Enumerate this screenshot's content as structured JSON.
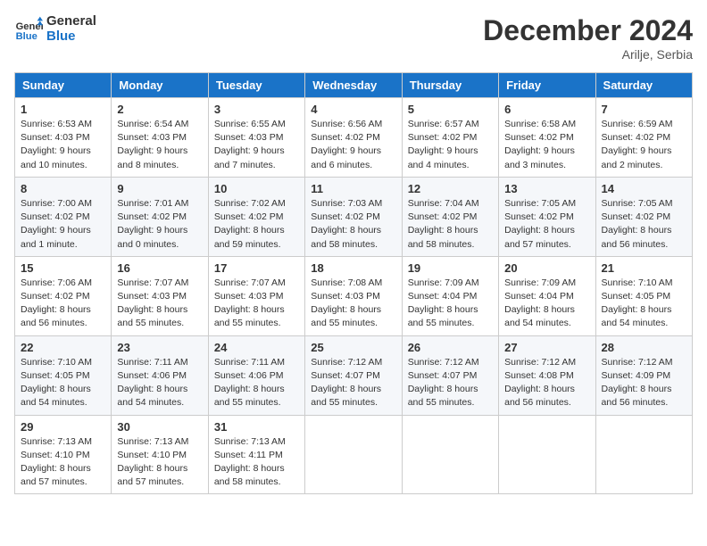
{
  "header": {
    "logo_line1": "General",
    "logo_line2": "Blue",
    "month_title": "December 2024",
    "location": "Arilje, Serbia"
  },
  "weekdays": [
    "Sunday",
    "Monday",
    "Tuesday",
    "Wednesday",
    "Thursday",
    "Friday",
    "Saturday"
  ],
  "weeks": [
    [
      {
        "day": "1",
        "info": "Sunrise: 6:53 AM\nSunset: 4:03 PM\nDaylight: 9 hours and 10 minutes."
      },
      {
        "day": "2",
        "info": "Sunrise: 6:54 AM\nSunset: 4:03 PM\nDaylight: 9 hours and 8 minutes."
      },
      {
        "day": "3",
        "info": "Sunrise: 6:55 AM\nSunset: 4:03 PM\nDaylight: 9 hours and 7 minutes."
      },
      {
        "day": "4",
        "info": "Sunrise: 6:56 AM\nSunset: 4:02 PM\nDaylight: 9 hours and 6 minutes."
      },
      {
        "day": "5",
        "info": "Sunrise: 6:57 AM\nSunset: 4:02 PM\nDaylight: 9 hours and 4 minutes."
      },
      {
        "day": "6",
        "info": "Sunrise: 6:58 AM\nSunset: 4:02 PM\nDaylight: 9 hours and 3 minutes."
      },
      {
        "day": "7",
        "info": "Sunrise: 6:59 AM\nSunset: 4:02 PM\nDaylight: 9 hours and 2 minutes."
      }
    ],
    [
      {
        "day": "8",
        "info": "Sunrise: 7:00 AM\nSunset: 4:02 PM\nDaylight: 9 hours and 1 minute."
      },
      {
        "day": "9",
        "info": "Sunrise: 7:01 AM\nSunset: 4:02 PM\nDaylight: 9 hours and 0 minutes."
      },
      {
        "day": "10",
        "info": "Sunrise: 7:02 AM\nSunset: 4:02 PM\nDaylight: 8 hours and 59 minutes."
      },
      {
        "day": "11",
        "info": "Sunrise: 7:03 AM\nSunset: 4:02 PM\nDaylight: 8 hours and 58 minutes."
      },
      {
        "day": "12",
        "info": "Sunrise: 7:04 AM\nSunset: 4:02 PM\nDaylight: 8 hours and 58 minutes."
      },
      {
        "day": "13",
        "info": "Sunrise: 7:05 AM\nSunset: 4:02 PM\nDaylight: 8 hours and 57 minutes."
      },
      {
        "day": "14",
        "info": "Sunrise: 7:05 AM\nSunset: 4:02 PM\nDaylight: 8 hours and 56 minutes."
      }
    ],
    [
      {
        "day": "15",
        "info": "Sunrise: 7:06 AM\nSunset: 4:02 PM\nDaylight: 8 hours and 56 minutes."
      },
      {
        "day": "16",
        "info": "Sunrise: 7:07 AM\nSunset: 4:03 PM\nDaylight: 8 hours and 55 minutes."
      },
      {
        "day": "17",
        "info": "Sunrise: 7:07 AM\nSunset: 4:03 PM\nDaylight: 8 hours and 55 minutes."
      },
      {
        "day": "18",
        "info": "Sunrise: 7:08 AM\nSunset: 4:03 PM\nDaylight: 8 hours and 55 minutes."
      },
      {
        "day": "19",
        "info": "Sunrise: 7:09 AM\nSunset: 4:04 PM\nDaylight: 8 hours and 55 minutes."
      },
      {
        "day": "20",
        "info": "Sunrise: 7:09 AM\nSunset: 4:04 PM\nDaylight: 8 hours and 54 minutes."
      },
      {
        "day": "21",
        "info": "Sunrise: 7:10 AM\nSunset: 4:05 PM\nDaylight: 8 hours and 54 minutes."
      }
    ],
    [
      {
        "day": "22",
        "info": "Sunrise: 7:10 AM\nSunset: 4:05 PM\nDaylight: 8 hours and 54 minutes."
      },
      {
        "day": "23",
        "info": "Sunrise: 7:11 AM\nSunset: 4:06 PM\nDaylight: 8 hours and 54 minutes."
      },
      {
        "day": "24",
        "info": "Sunrise: 7:11 AM\nSunset: 4:06 PM\nDaylight: 8 hours and 55 minutes."
      },
      {
        "day": "25",
        "info": "Sunrise: 7:12 AM\nSunset: 4:07 PM\nDaylight: 8 hours and 55 minutes."
      },
      {
        "day": "26",
        "info": "Sunrise: 7:12 AM\nSunset: 4:07 PM\nDaylight: 8 hours and 55 minutes."
      },
      {
        "day": "27",
        "info": "Sunrise: 7:12 AM\nSunset: 4:08 PM\nDaylight: 8 hours and 56 minutes."
      },
      {
        "day": "28",
        "info": "Sunrise: 7:12 AM\nSunset: 4:09 PM\nDaylight: 8 hours and 56 minutes."
      }
    ],
    [
      {
        "day": "29",
        "info": "Sunrise: 7:13 AM\nSunset: 4:10 PM\nDaylight: 8 hours and 57 minutes."
      },
      {
        "day": "30",
        "info": "Sunrise: 7:13 AM\nSunset: 4:10 PM\nDaylight: 8 hours and 57 minutes."
      },
      {
        "day": "31",
        "info": "Sunrise: 7:13 AM\nSunset: 4:11 PM\nDaylight: 8 hours and 58 minutes."
      },
      null,
      null,
      null,
      null
    ]
  ]
}
